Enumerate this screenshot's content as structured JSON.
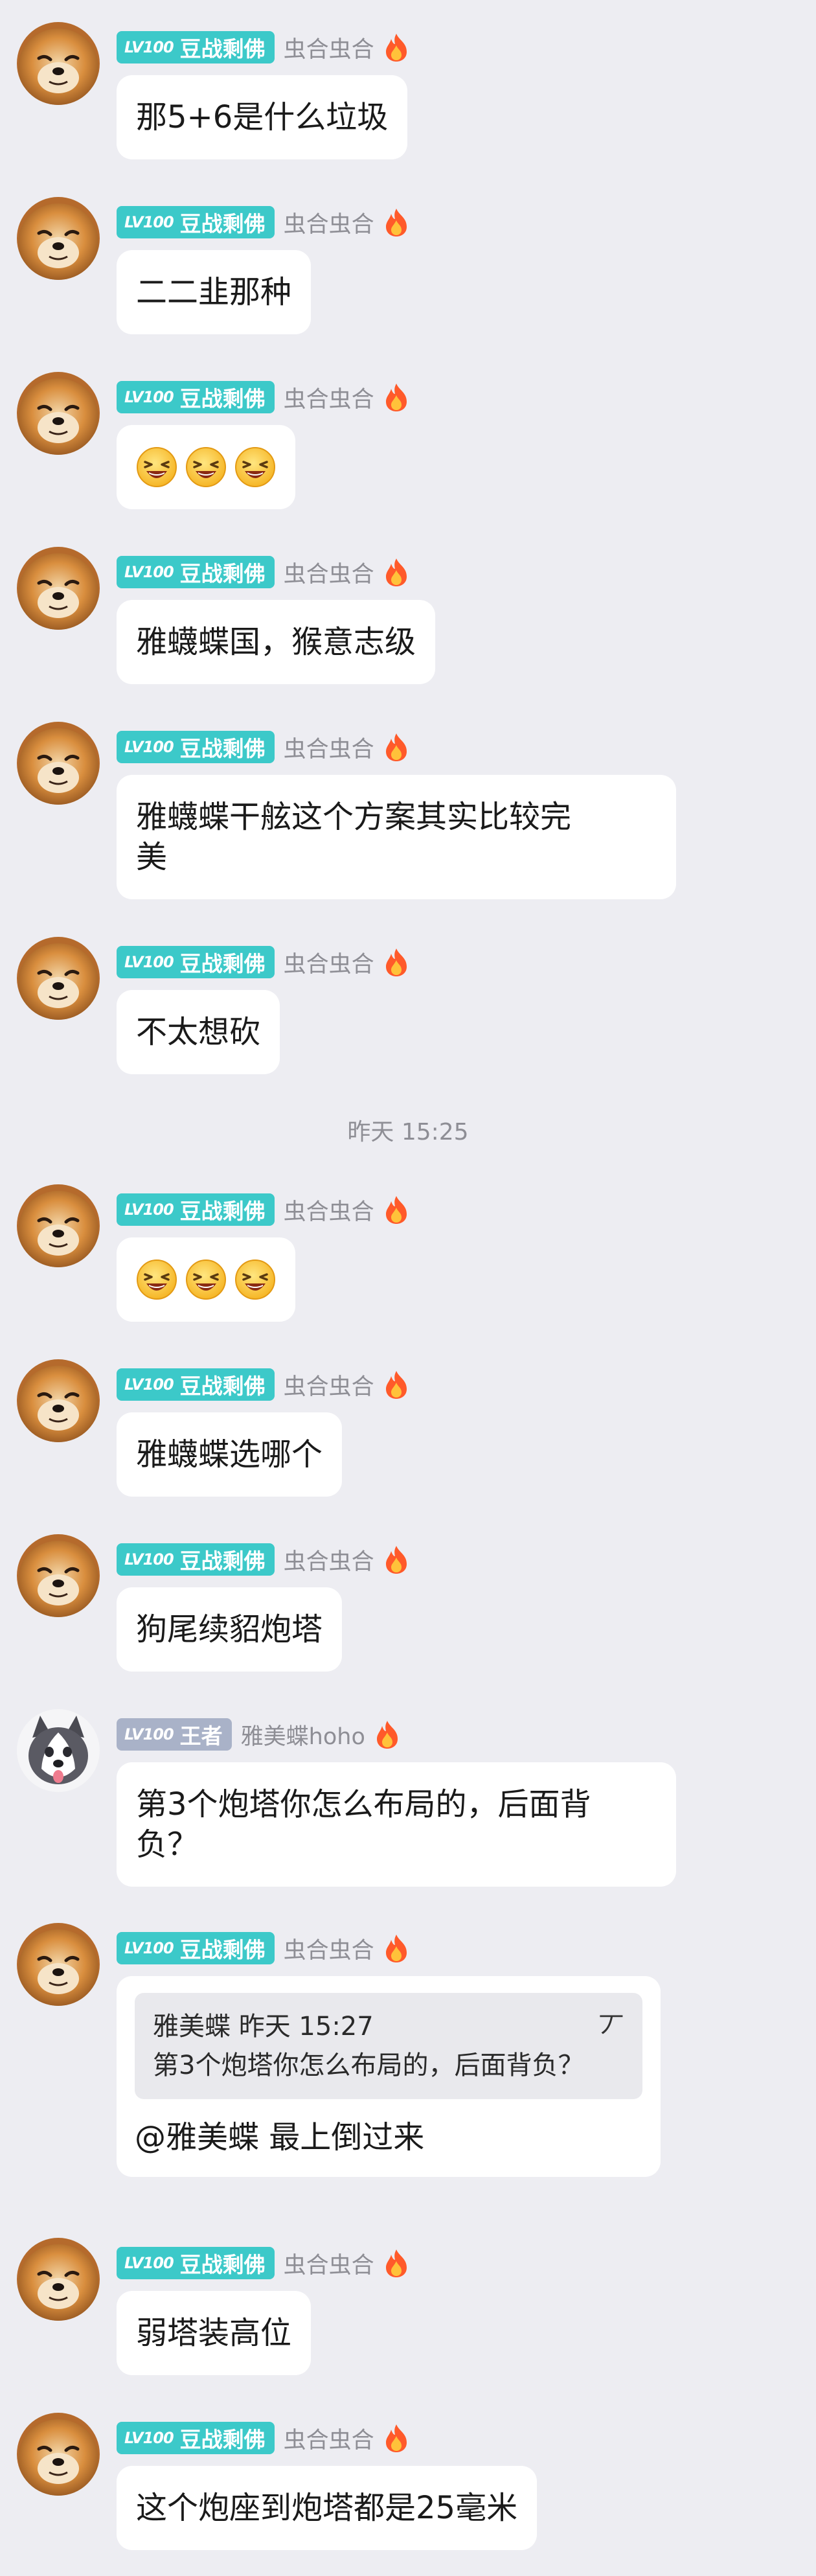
{
  "colors": {
    "background": "#ededf2",
    "bubble": "#ffffff",
    "badge_teal": "#3cc9c9",
    "badge_grey": "#a9b2c8",
    "meta_text": "#8e8e95"
  },
  "messages": [
    {
      "badge_level": "LV100",
      "badge_title": "豆战剩佛",
      "sender": "虫合虫合",
      "text": "那5+6是什么垃圾"
    },
    {
      "badge_level": "LV100",
      "badge_title": "豆战剩佛",
      "sender": "虫合虫合",
      "text": "二二韭那种"
    },
    {
      "badge_level": "LV100",
      "badge_title": "豆战剩佛",
      "sender": "虫合虫合",
      "emoji": "laughing-face-icon x3"
    },
    {
      "badge_level": "LV100",
      "badge_title": "豆战剩佛",
      "sender": "虫合虫合",
      "text": "雅蠛蝶国，猴意志级"
    },
    {
      "badge_level": "LV100",
      "badge_title": "豆战剩佛",
      "sender": "虫合虫合",
      "line1": "雅蠛蝶干舷这个方案其实比较完",
      "line2": "美"
    },
    {
      "badge_level": "LV100",
      "badge_title": "豆战剩佛",
      "sender": "虫合虫合",
      "text": "不太想砍"
    },
    {
      "badge_level": "LV100",
      "badge_title": "豆战剩佛",
      "sender": "虫合虫合",
      "emoji": "laughing-face-icon x3"
    },
    {
      "badge_level": "LV100",
      "badge_title": "豆战剩佛",
      "sender": "虫合虫合",
      "text": "雅蠛蝶选哪个"
    },
    {
      "badge_level": "LV100",
      "badge_title": "豆战剩佛",
      "sender": "虫合虫合",
      "text": "狗尾续貂炮塔"
    },
    {
      "badge_level": "LV100",
      "badge_title": "王者",
      "sender": "雅美蝶hoho",
      "line1": "第3个炮塔你怎么布局的，后面背",
      "line2": "负？"
    },
    {
      "badge_level": "LV100",
      "badge_title": "豆战剩佛",
      "sender": "虫合虫合",
      "quote_author": "雅美蝶 昨天 15:27",
      "quote_mark": "丆",
      "quote_text": "第3个炮塔你怎么布局的，后面背负？",
      "text": "@雅美蝶 最上倒过来"
    },
    {
      "badge_level": "LV100",
      "badge_title": "豆战剩佛",
      "sender": "虫合虫合",
      "text": "弱塔装高位"
    },
    {
      "badge_level": "LV100",
      "badge_title": "豆战剩佛",
      "sender": "虫合虫合",
      "text": "这个炮座到炮塔都是25毫米"
    }
  ],
  "timestamp": "昨天 15:25"
}
